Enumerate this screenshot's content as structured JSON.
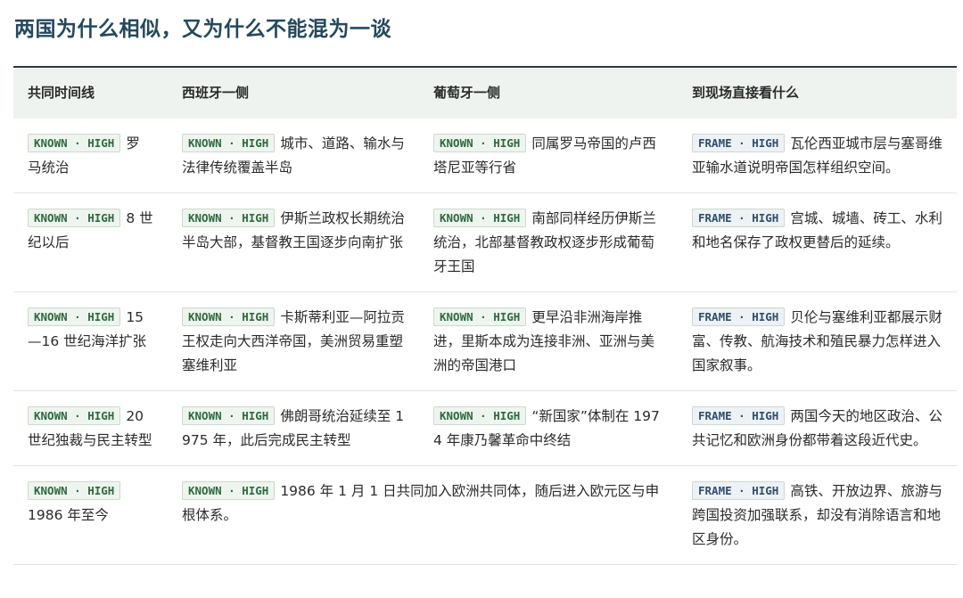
{
  "title": "两国为什么相似，又为什么不能混为一谈",
  "headers": [
    "共同时间线",
    "西班牙一侧",
    "葡萄牙一侧",
    "到现场直接看什么"
  ],
  "tags": {
    "known": "KNOWN · HIGH",
    "frame": "FRAME · HIGH"
  },
  "rows": [
    {
      "timeline": "罗马统治",
      "spain": "城市、道路、输水与法律传统覆盖半岛",
      "portugal": "同属罗马帝国的卢西塔尼亚等行省",
      "see": "瓦伦西亚城市层与塞哥维亚输水道说明帝国怎样组织空间。"
    },
    {
      "timeline": "8 世纪以后",
      "spain": "伊斯兰政权长期统治半岛大部，基督教王国逐步向南扩张",
      "portugal": "南部同样经历伊斯兰统治，北部基督教政权逐步形成葡萄牙王国",
      "see": "宫城、城墙、砖工、水利和地名保存了政权更替后的延续。"
    },
    {
      "timeline": "15—16 世纪海洋扩张",
      "spain": "卡斯蒂利亚—阿拉贡王权走向大西洋帝国，美洲贸易重塑塞维利亚",
      "portugal": "更早沿非洲海岸推进，里斯本成为连接非洲、亚洲与美洲的帝国港口",
      "see": "贝伦与塞维利亚都展示财富、传教、航海技术和殖民暴力怎样进入国家叙事。"
    },
    {
      "timeline": "20 世纪独裁与民主转型",
      "spain": "佛朗哥统治延续至 1975 年，此后完成民主转型",
      "portugal": "“新国家”体制在 1974 年康乃馨革命中终结",
      "see": "两国今天的地区政治、公共记忆和欧洲身份都带着这段近代史。"
    }
  ],
  "last_row": {
    "timeline": "1986 年至今",
    "shared": "1986 年 1 月 1 日共同加入欧洲共同体，随后进入欧元区与申根体系。",
    "see": "高铁、开放边界、旅游与跨国投资加强联系，却没有消除语言和地区身份。"
  }
}
